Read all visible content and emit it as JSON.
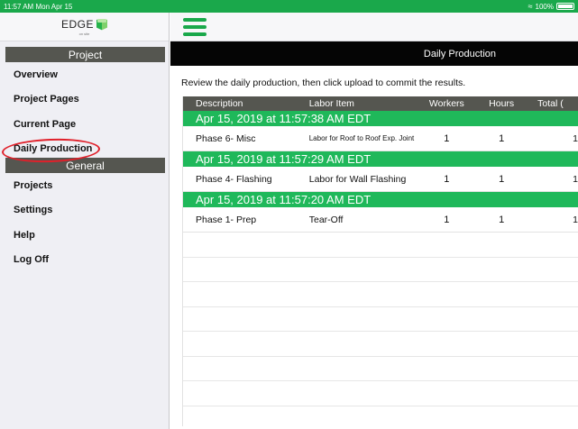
{
  "status_bar": {
    "time": "11:57 AM",
    "date": "Mon Apr 15",
    "battery": "100%"
  },
  "app": {
    "logo_text": "EDGE",
    "logo_sub": "on site"
  },
  "sidebar": {
    "sections": [
      {
        "title": "Project",
        "items": [
          "Overview",
          "Project Pages",
          "Current Page",
          "Daily Production"
        ]
      },
      {
        "title": "General",
        "items": [
          "Projects",
          "Settings",
          "Help",
          "Log Off"
        ]
      }
    ]
  },
  "header": {
    "title": "Daily Production"
  },
  "main": {
    "intro": "Review the daily production, then click upload to commit the results."
  },
  "table": {
    "columns": [
      "Description",
      "Labor Item",
      "Workers",
      "Hours",
      "Total ("
    ],
    "groups": [
      {
        "timestamp": "Apr 15, 2019 at 11:57:38 AM EDT",
        "description": "Phase 6- Misc",
        "labor_item": "Labor for Roof to Roof Exp. Joint",
        "workers": "1",
        "hours": "1",
        "total": "1"
      },
      {
        "timestamp": "Apr 15, 2019 at 11:57:29 AM EDT",
        "description": "Phase 4- Flashing",
        "labor_item": "Labor for Wall Flashing",
        "workers": "1",
        "hours": "1",
        "total": "1"
      },
      {
        "timestamp": "Apr 15, 2019 at 11:57:20 AM EDT",
        "description": "Phase 1- Prep",
        "labor_item": "Tear-Off",
        "workers": "1",
        "hours": "1",
        "total": "1"
      }
    ]
  },
  "colors": {
    "accent": "#1fb85a",
    "header_bg": "#555650",
    "title_bar": "#050505",
    "highlight_circle": "#e0202a"
  }
}
